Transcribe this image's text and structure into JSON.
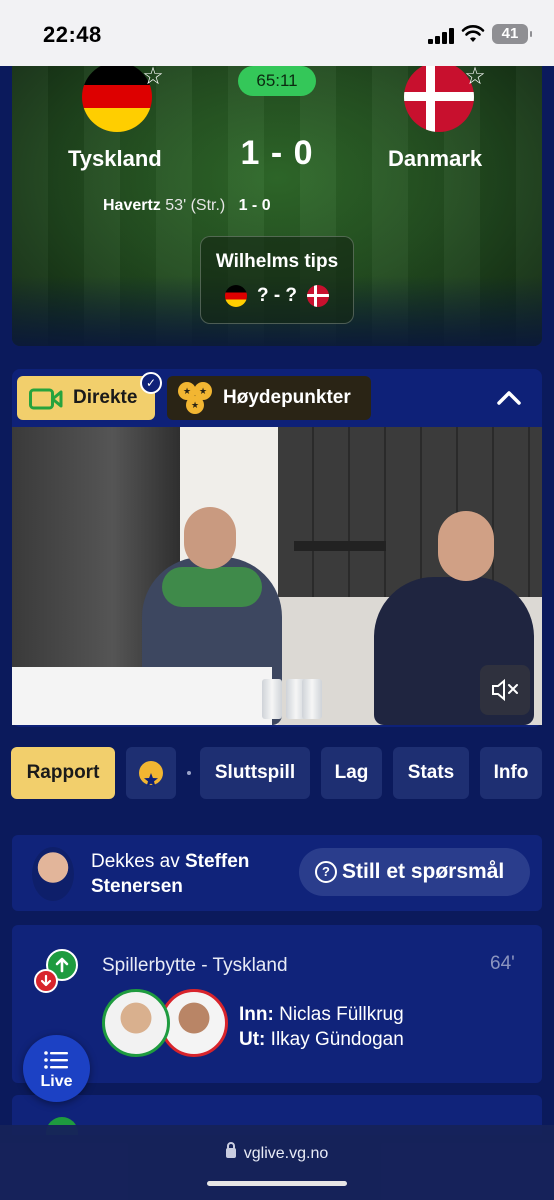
{
  "status": {
    "time": "22:48",
    "battery": "41"
  },
  "match": {
    "clock": "65:11",
    "home": "Tyskland",
    "away": "Danmark",
    "score": "1 - 0",
    "goal": {
      "player": "Havertz",
      "minute": "53' (Str.)",
      "score": "1 - 0"
    },
    "tips": {
      "title": "Wilhelms tips",
      "score": "? - ?"
    }
  },
  "media_tabs": {
    "live": "Direkte",
    "highlights": "Høydepunkter"
  },
  "nav": {
    "items": [
      "Rapport",
      "Sluttspill",
      "Lag",
      "Stats",
      "Info"
    ],
    "active": "Rapport"
  },
  "reporter": {
    "prefix": "Dekkes av ",
    "name_first": "Steffen",
    "name_last": "Stenersen",
    "ask": "Still et spørsmål"
  },
  "event": {
    "title": "Spillerbytte - Tyskland",
    "minute": "64'",
    "in_label": "Inn:",
    "in_player": "Niclas Füllkrug",
    "out_label": "Ut:",
    "out_player": "Ilkay Gündogan"
  },
  "fab": {
    "label": "Live"
  },
  "browser": {
    "url": "vglive.vg.no"
  },
  "colors": {
    "background": "#0b1a5c",
    "accent_yellow": "#f2cf6c",
    "clock_green": "#34c759",
    "card": "#10237a"
  }
}
